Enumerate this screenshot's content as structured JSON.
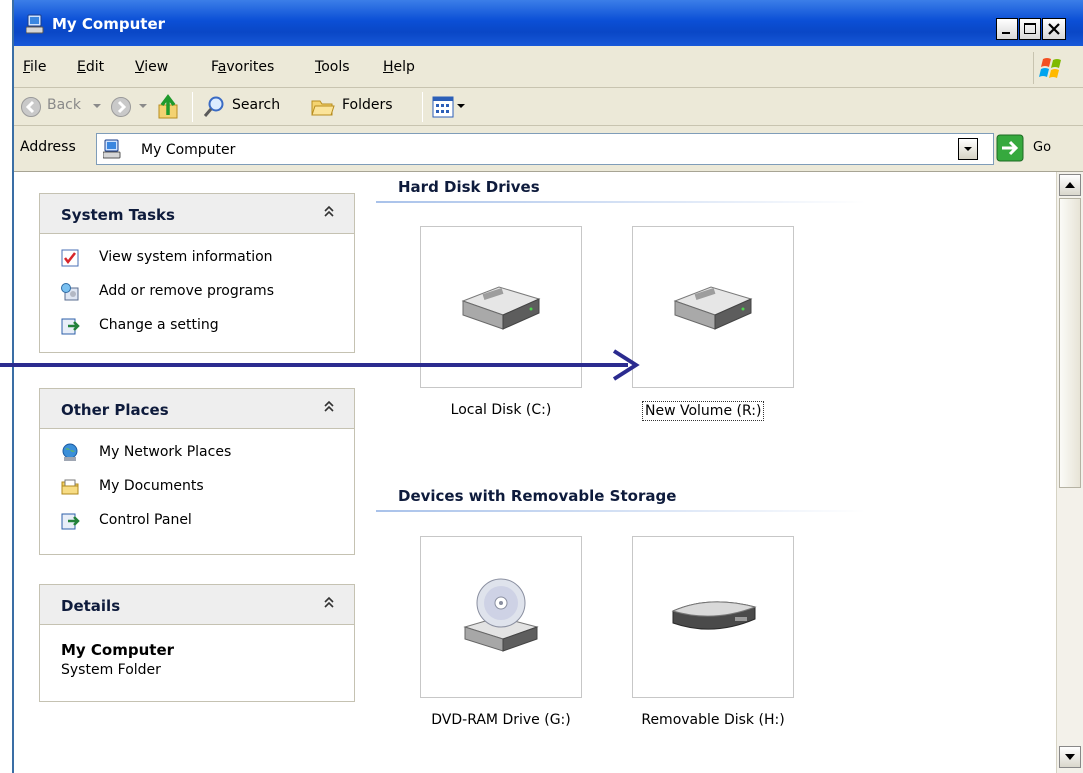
{
  "window": {
    "title": "My Computer"
  },
  "menu": [
    {
      "label": "File",
      "ul": "F",
      "rest": "ile"
    },
    {
      "label": "Edit",
      "ul": "E",
      "rest": "dit"
    },
    {
      "label": "View",
      "ul": "V",
      "rest": "iew"
    },
    {
      "label": "Favorites",
      "pre": "F",
      "ul": "a",
      "rest": "vorites"
    },
    {
      "label": "Tools",
      "ul": "T",
      "rest": "ools"
    },
    {
      "label": "Help",
      "ul": "H",
      "rest": "elp"
    }
  ],
  "toolbar": {
    "back": "Back",
    "search": "Search",
    "folders": "Folders"
  },
  "address": {
    "label": "Address",
    "value": "My Computer",
    "go": "Go"
  },
  "panels": {
    "system_tasks": {
      "title": "System Tasks",
      "items": [
        "View system information",
        "Add or remove programs",
        "Change a setting"
      ]
    },
    "other_places": {
      "title": "Other Places",
      "items": [
        "My Network Places",
        "My Documents",
        "Control Panel"
      ]
    },
    "details": {
      "title": "Details",
      "name": "My Computer",
      "type": "System Folder"
    }
  },
  "groups": {
    "hard_disks": {
      "title": "Hard Disk Drives",
      "items": [
        "Local Disk (C:)",
        "New Volume (R:)"
      ]
    },
    "removable": {
      "title": "Devices with Removable Storage",
      "items": [
        "DVD-RAM Drive (G:)",
        "Removable Disk (H:)"
      ]
    }
  },
  "colors": {
    "titlebar": "#0b4fd6",
    "panel_title": "#0e1b3c",
    "arrow": "#2b2b8f",
    "group_line": "#a9c2ea"
  }
}
